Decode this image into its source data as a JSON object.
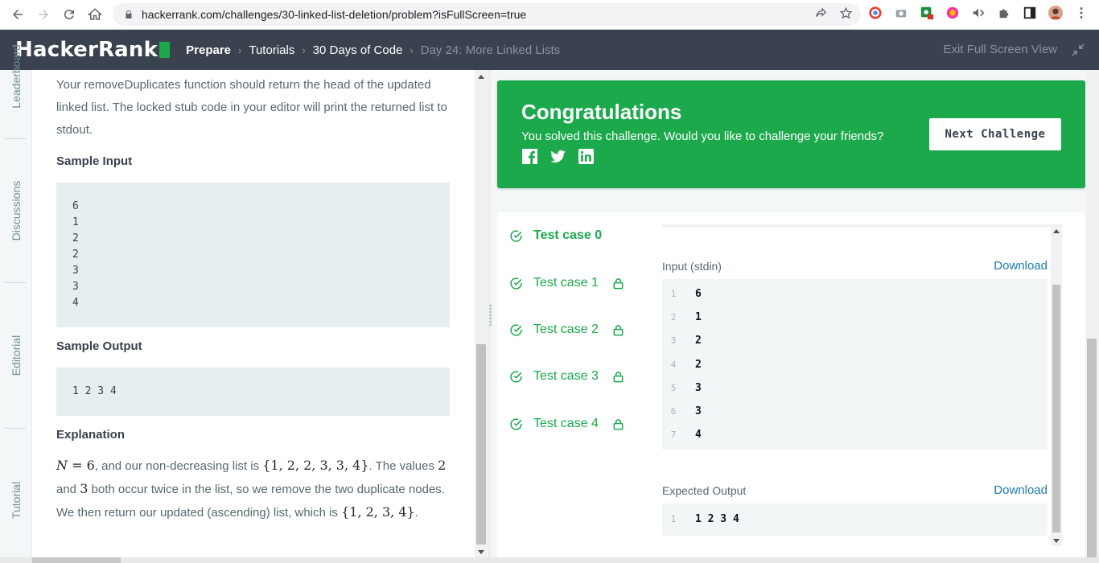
{
  "browser": {
    "url": "hackerrank.com/challenges/30-linked-list-deletion/problem?isFullScreen=true"
  },
  "header": {
    "logo": "HackerRank",
    "breadcrumbs": [
      "Prepare",
      "Tutorials",
      "30 Days of Code",
      "Day 24: More Linked Lists"
    ],
    "exit_full_screen": "Exit Full Screen View"
  },
  "side_tabs": [
    "Leaderboard",
    "Discussions",
    "Editorial",
    "Tutorial"
  ],
  "problem": {
    "intro": "Your removeDuplicates function should return the head of the updated linked list. The locked stub code in your editor will print the returned list to stdout.",
    "sample_input_heading": "Sample Input",
    "sample_input": [
      "6",
      "1",
      "2",
      "2",
      "3",
      "3",
      "4"
    ],
    "sample_output_heading": "Sample Output",
    "sample_output": "1 2 3 4",
    "explanation_heading": "Explanation",
    "explanation": {
      "n_var": "N",
      "n_eq": " = 6",
      "part1": ", and our non-decreasing list is ",
      "list1": "{1, 2, 2, 3, 3, 4}",
      "part2": ". The values ",
      "v1": "2",
      "and": " and ",
      "v2": "3",
      "part3": " both occur twice in the list, so we remove the two duplicate nodes. We then return our updated (ascending) list, which is ",
      "list2": "{1, 2, 3, 4}",
      "end": "."
    }
  },
  "congrats": {
    "title": "Congratulations",
    "subtitle": "You solved this challenge. Would you like to challenge your friends?",
    "next_button": "Next Challenge",
    "color": "#1ba94c"
  },
  "test_cases": [
    {
      "label": "Test case 0",
      "locked": false,
      "active": true
    },
    {
      "label": "Test case 1",
      "locked": true,
      "active": false
    },
    {
      "label": "Test case 2",
      "locked": true,
      "active": false
    },
    {
      "label": "Test case 3",
      "locked": true,
      "active": false
    },
    {
      "label": "Test case 4",
      "locked": true,
      "active": false
    }
  ],
  "detail": {
    "input_label": "Input (stdin)",
    "download": "Download",
    "input_lines": [
      {
        "n": "1",
        "v": "6"
      },
      {
        "n": "2",
        "v": "1"
      },
      {
        "n": "3",
        "v": "2"
      },
      {
        "n": "4",
        "v": "2"
      },
      {
        "n": "5",
        "v": "3"
      },
      {
        "n": "6",
        "v": "3"
      },
      {
        "n": "7",
        "v": "4"
      }
    ],
    "expected_label": "Expected Output",
    "expected_lines": [
      {
        "n": "1",
        "v": "1 2 3 4"
      }
    ]
  }
}
